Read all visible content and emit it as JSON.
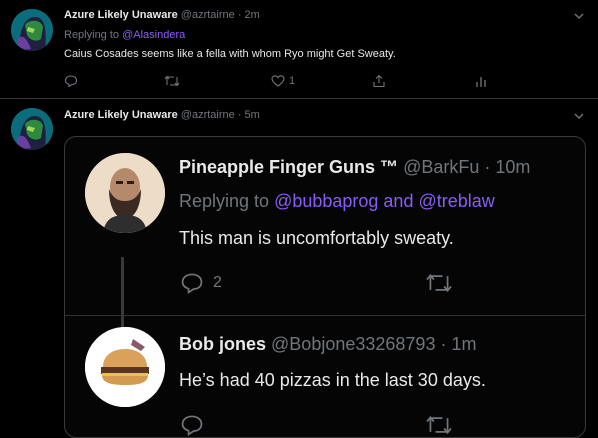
{
  "tweets": [
    {
      "name": "Azure Likely Unaware",
      "handle": "@azrtairne",
      "time": "· 2m",
      "replying_prefix": "Replying to ",
      "replying_to": "@Alasindera",
      "text": "Caius Cosades seems like a fella with whom Ryo might Get Sweaty.",
      "actions": {
        "reply_count": "",
        "retweet_count": "",
        "like_count": "1"
      }
    },
    {
      "name": "Azure Likely Unaware",
      "handle": "@azrtairne",
      "time": "· 5m"
    }
  ],
  "quote": {
    "first": {
      "name": "Pineapple Finger Guns ™",
      "handle": "@BarkFu",
      "time": "· 10m",
      "replying_prefix": "Replying to ",
      "replying_to_1": "@bubbaprog",
      "replying_and": " and ",
      "replying_to_2": "@treblaw",
      "text": "This man is uncomfortably sweaty.",
      "reply_count": "2"
    },
    "second": {
      "name": "Bob jones",
      "handle": "@Bobjone33268793",
      "time": "· 1m",
      "text": "He’s had 40 pizzas in the last 30 days."
    }
  },
  "colors": {
    "background": "#000000",
    "text": "#e7e9ea",
    "muted": "#71767b",
    "link": "#8b5cf6",
    "border": "#2f3336"
  },
  "icons": [
    "chevron-down-icon",
    "reply-icon",
    "retweet-icon",
    "like-icon",
    "share-icon",
    "analytics-icon"
  ]
}
